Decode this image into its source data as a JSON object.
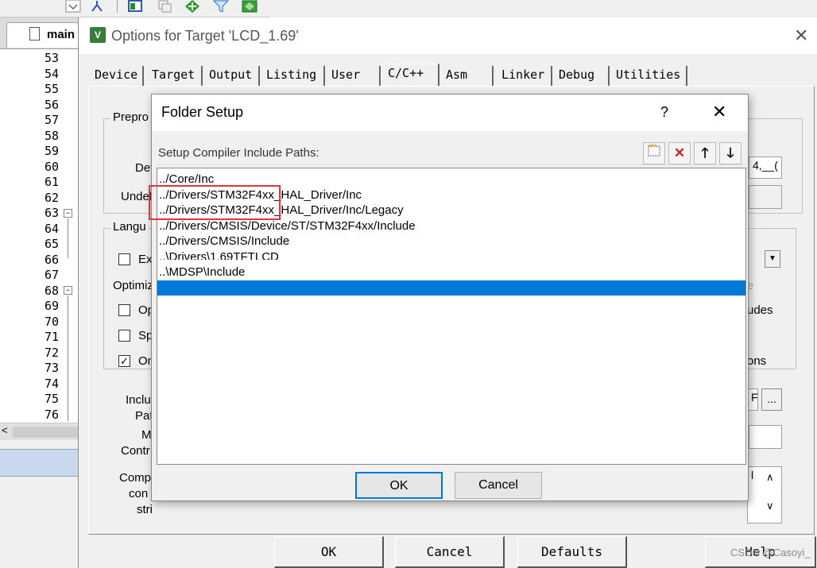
{
  "ide": {
    "editor_tab": "main",
    "line_numbers": [
      "53",
      "54",
      "55",
      "56",
      "57",
      "58",
      "59",
      "60",
      "61",
      "62",
      "63",
      "64",
      "65",
      "66",
      "67",
      "68",
      "69",
      "70",
      "71",
      "72",
      "73",
      "74",
      "75",
      "76"
    ],
    "hscroll_arrow": "<"
  },
  "options_dialog": {
    "title": "Options for Target 'LCD_1.69'",
    "close_icon": "close-icon",
    "tabs": [
      {
        "label": "Device"
      },
      {
        "label": "Target"
      },
      {
        "label": "Output"
      },
      {
        "label": "Listing"
      },
      {
        "label": "User"
      },
      {
        "label": "C/C++",
        "active": true
      },
      {
        "label": "Asm"
      },
      {
        "label": "Linker"
      },
      {
        "label": "Debug"
      },
      {
        "label": "Utilities"
      }
    ],
    "partial_labels": {
      "preprocessor": "Prepro",
      "define": "Def",
      "undefine": "Undef",
      "language": "Langu",
      "ex": "Ex",
      "optimization": "Optimiz",
      "op": "Op",
      "sp": "Sp",
      "on": "On",
      "include": "Inclu",
      "paths": "Pat",
      "misc": "M",
      "controls": "Contr",
      "compiler": "Comp",
      "control": "con",
      "string": "stri"
    },
    "right_partial": {
      "define_value": "4,__(",
      "e_text": "e",
      "udes": "udes",
      "ons": "ons",
      "f": "F",
      "l": "l"
    },
    "checkbox_on": "✓",
    "browse_label": "...",
    "footer": {
      "ok": "OK",
      "cancel": "Cancel",
      "defaults": "Defaults",
      "help": "Help"
    },
    "watermark": "CSDN @Casoyi_"
  },
  "folder_setup": {
    "title": "Folder Setup",
    "help": "?",
    "close_icon": "close-icon",
    "header_label": "Setup Compiler Include Paths:",
    "tool_icons": [
      "new-folder-icon",
      "delete-icon",
      "move-up-icon",
      "move-down-icon"
    ],
    "paths": [
      "../Core/Inc",
      "../Drivers/STM32F4xx_HAL_Driver/Inc",
      "../Drivers/STM32F4xx_HAL_Driver/Inc/Legacy",
      "../Drivers/CMSIS/Device/ST/STM32F4xx/Include",
      "../Drivers/CMSIS/Include",
      "..\\Drivers\\1.69TFTLCD",
      "..\\MDSP\\Include",
      ""
    ],
    "selected_index": 7,
    "highlight_color": "#e0353b",
    "selection_color": "#0078d7",
    "ok": "OK",
    "cancel": "Cancel"
  }
}
